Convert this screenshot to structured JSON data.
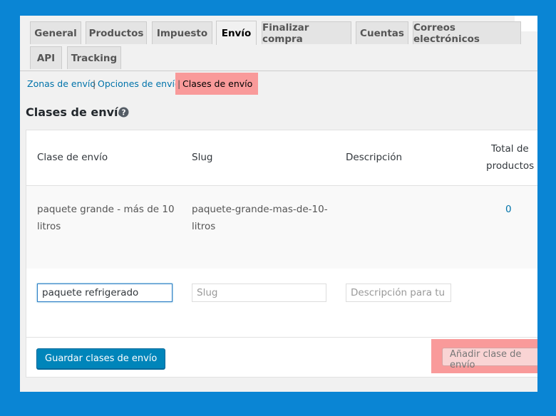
{
  "tabs": [
    {
      "label": "General"
    },
    {
      "label": "Productos"
    },
    {
      "label": "Impuesto"
    },
    {
      "label": "Envío",
      "active": true
    },
    {
      "label": "Finalizar compra"
    },
    {
      "label": "Cuentas"
    },
    {
      "label": "Correos electrónicos"
    },
    {
      "label": "API"
    },
    {
      "label": "Tracking"
    }
  ],
  "subnav": {
    "zones": "Zonas de envío",
    "options": "Opciones de envío",
    "classes": "Clases de envío",
    "separator": "|"
  },
  "page_title": "Clases de envío",
  "table": {
    "headers": {
      "class": "Clase de envío",
      "slug": "Slug",
      "description": "Descripción",
      "total_line1": "Total de",
      "total_line2": "productos"
    },
    "rows": [
      {
        "class_line1": "paquete grande - más de 10",
        "class_line2": "litros",
        "slug_line1": "paquete-grande-mas-de-10-",
        "slug_line2": "litros",
        "count": "0"
      }
    ],
    "new_row": {
      "name_value": "paquete refrigerado",
      "slug_placeholder": "Slug",
      "description_placeholder": "Descripción para tu re"
    }
  },
  "buttons": {
    "save": "Guardar clases de envío",
    "add": "Añadir clase de envío"
  },
  "colors": {
    "background": "#0a85d4",
    "link": "#0073aa",
    "primary_button": "#0085ba",
    "highlight": "#f99a9a"
  }
}
